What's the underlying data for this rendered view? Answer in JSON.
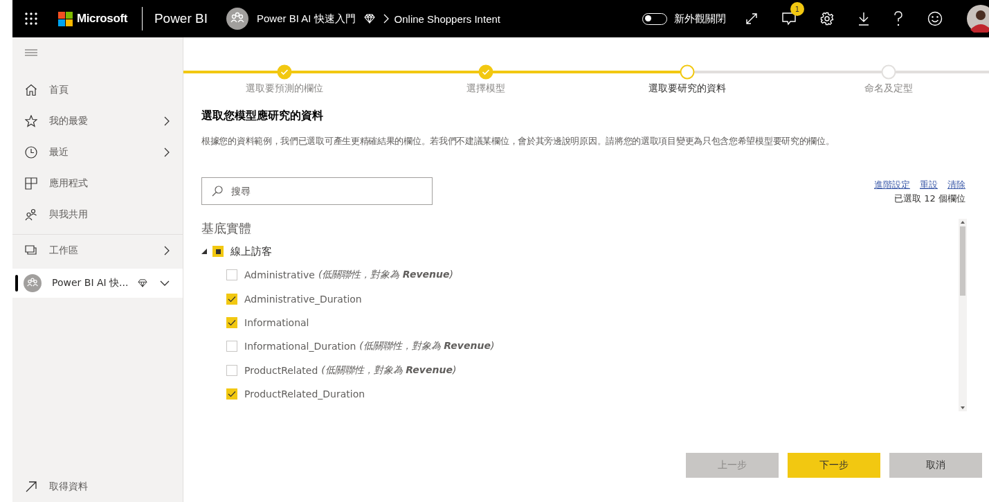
{
  "topbar": {
    "brand": "Microsoft",
    "product": "Power BI",
    "breadcrumb": [
      {
        "label": "Power BI AI 快速入門",
        "premium": true
      },
      {
        "label": "Online Shoppers Intent"
      }
    ],
    "toggle": {
      "label": "新外觀關閉",
      "on": false
    },
    "notifications": "1"
  },
  "sidebar": {
    "items": [
      {
        "label": "首頁",
        "chevron": false
      },
      {
        "label": "我的最愛",
        "chevron": true
      },
      {
        "label": "最近",
        "chevron": true
      },
      {
        "label": "應用程式",
        "chevron": false
      },
      {
        "label": "與我共用",
        "chevron": false
      }
    ],
    "workspaces": {
      "label": "工作區",
      "chevron": true
    },
    "current_workspace": {
      "label": "Power BI AI 快...",
      "selected": true,
      "expanded": true,
      "premium": true
    },
    "get_data": "取得資料"
  },
  "steps": [
    {
      "label": "選取要預測的欄位",
      "completed": true,
      "selected": false
    },
    {
      "label": "選擇模型",
      "completed": true,
      "selected": false
    },
    {
      "label": "選取要研究的資料",
      "completed": false,
      "selected": true
    },
    {
      "label": "命名及定型",
      "completed": false,
      "selected": false
    }
  ],
  "title": "選取您模型應研究的資料",
  "description": "根據您的資料範例，我們已選取可產生更精確結果的欄位。若我們不建議某欄位，會於其旁邊說明原因。請將您的選取項目變更為只包含您希望模型要研究的欄位。",
  "search": {
    "placeholder": "搜尋"
  },
  "links": [
    "進階設定",
    "重設",
    "清除"
  ],
  "selection_count": "已選取 12 個欄位",
  "entity_heading": "基底實體",
  "tree": {
    "label": "線上訪客",
    "expanded": true,
    "indeterminate": true,
    "children": [
      {
        "label": "Administrative",
        "note": "(低關聯性，對象為 **Revenue**)",
        "checked": false
      },
      {
        "label": "Administrative_Duration",
        "checked": true
      },
      {
        "label": "Informational",
        "checked": true
      },
      {
        "label": "Informational_Duration",
        "note": "(低關聯性，對象為 **Revenue**)",
        "checked": false
      },
      {
        "label": "ProductRelated",
        "note": "(低關聯性，對象為 **Revenue**)",
        "checked": false
      },
      {
        "label": "ProductRelated_Duration",
        "checked": true
      }
    ]
  },
  "buttons": [
    {
      "label": "上一步",
      "kind": "secondary",
      "disabled": true
    },
    {
      "label": "下一步",
      "kind": "primary",
      "disabled": false
    },
    {
      "label": "取消",
      "kind": "secondary",
      "disabled": false
    }
  ]
}
